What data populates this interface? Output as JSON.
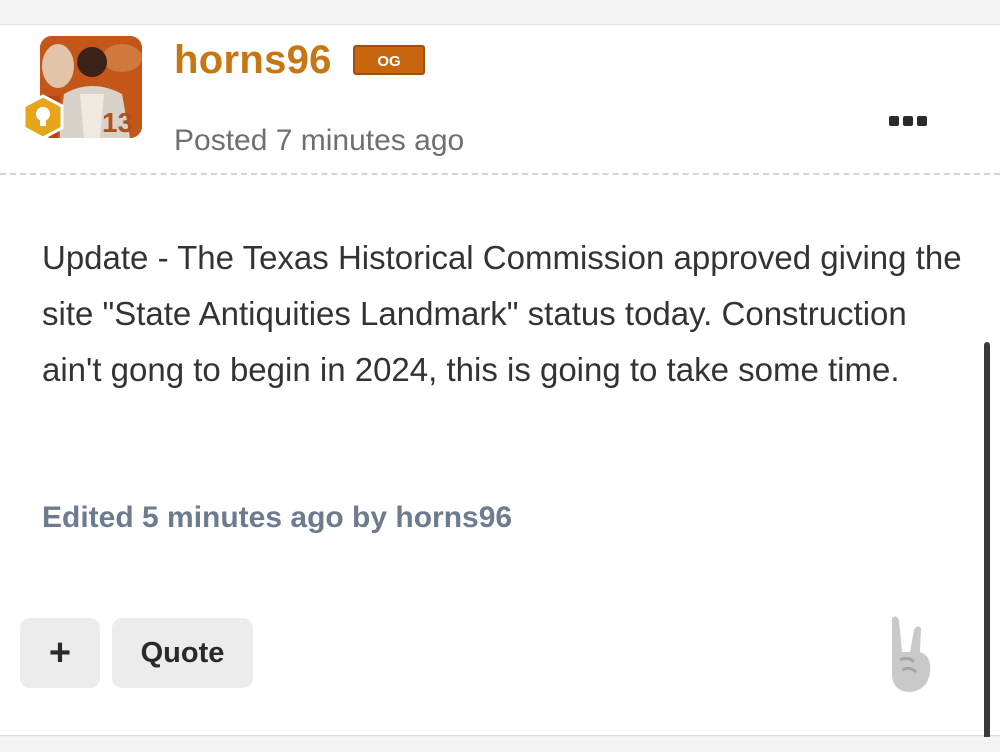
{
  "post": {
    "author": "horns96",
    "author_badge": "OG",
    "posted": "Posted 7 minutes ago",
    "body": "Update - The Texas Historical Commission approved giving the site \"State Antiquities Landmark\" status today.  Construction ain't gong to begin in 2024,  this is going to take some time.",
    "edited": "Edited 5 minutes ago by horns96"
  },
  "actions": {
    "plus_label": "+",
    "quote_label": "Quote"
  },
  "avatar": {
    "jersey_number": "13"
  },
  "colors": {
    "author": "#c87611",
    "badge": "#c8650f",
    "edited": "#6d7b8f",
    "body_text": "#333333"
  },
  "icons": {
    "more": "more-options-icon",
    "rank": "lightbulb-rank-icon",
    "reaction": "hook-em-horns-icon"
  }
}
